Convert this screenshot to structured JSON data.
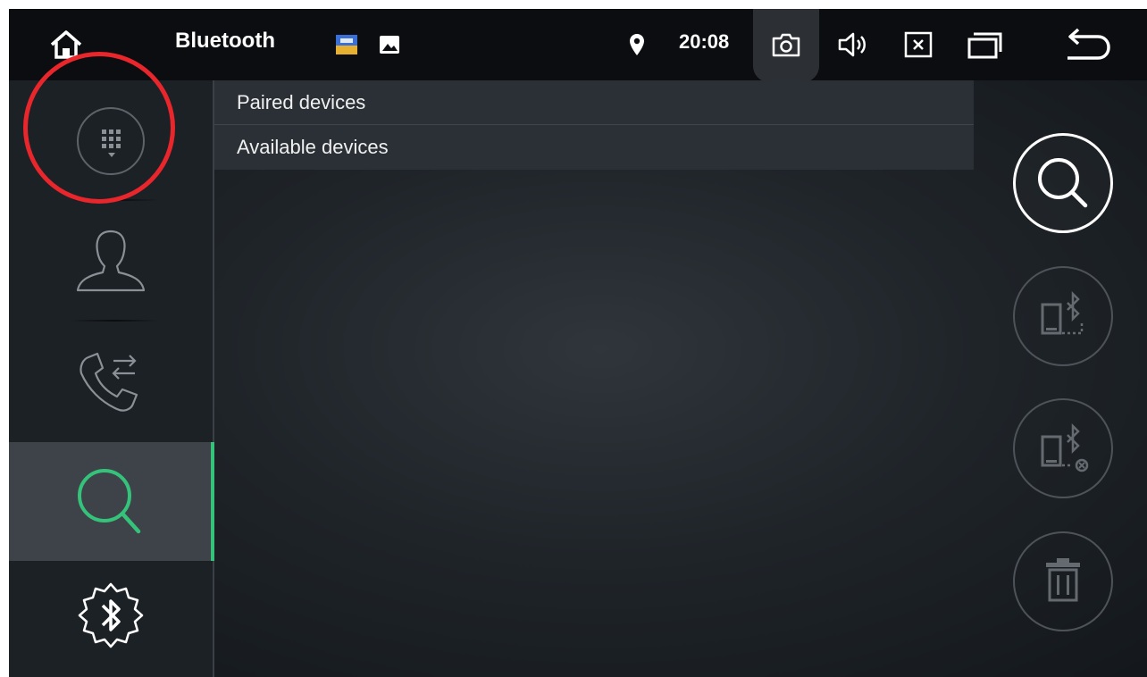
{
  "status_bar": {
    "title": "Bluetooth",
    "time": "20:08",
    "icons": [
      "home-icon",
      "app-thumbnail-icon",
      "image-icon",
      "location-icon",
      "camera-icon",
      "volume-icon",
      "close-window-icon",
      "recent-apps-icon",
      "back-icon"
    ]
  },
  "sidebar": {
    "items": [
      {
        "name": "dialpad",
        "icon": "dialpad-icon"
      },
      {
        "name": "contacts",
        "icon": "contact-icon"
      },
      {
        "name": "call-log",
        "icon": "call-log-icon"
      },
      {
        "name": "search-devices",
        "icon": "search-icon",
        "active": true
      },
      {
        "name": "bluetooth-settings",
        "icon": "bluetooth-settings-icon"
      }
    ],
    "active_color": "#35c27a"
  },
  "device_list": {
    "rows": [
      {
        "label": "Paired devices"
      },
      {
        "label": "Available devices"
      }
    ]
  },
  "actions": [
    {
      "name": "search",
      "icon": "search-icon",
      "enabled": true
    },
    {
      "name": "connect",
      "icon": "connect-device-icon",
      "enabled": false
    },
    {
      "name": "disconnect",
      "icon": "disconnect-device-icon",
      "enabled": false
    },
    {
      "name": "delete",
      "icon": "trash-icon",
      "enabled": false
    }
  ],
  "annotation": {
    "color": "#e8262b"
  }
}
